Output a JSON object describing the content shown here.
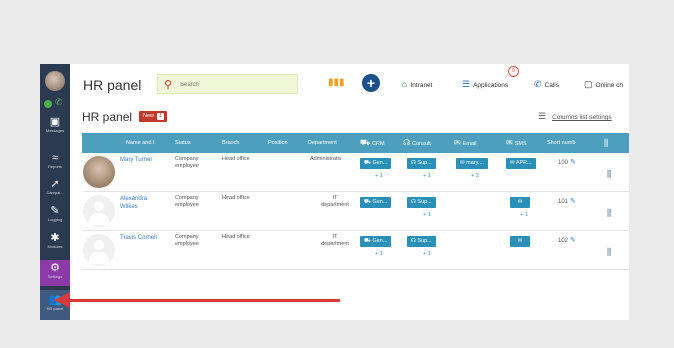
{
  "sidebar": {
    "items": [
      {
        "icon": "messages-icon",
        "label": "Messages"
      },
      {
        "icon": "reports-icon",
        "label": "Reports"
      },
      {
        "icon": "campaigns-icon",
        "label": "Campai..."
      },
      {
        "icon": "logging-icon",
        "label": "Logging"
      },
      {
        "icon": "modules-icon",
        "label": "Modules"
      },
      {
        "icon": "settings-icon",
        "label": "Settings"
      },
      {
        "icon": "hr-panel-icon",
        "label": "HR panel"
      }
    ]
  },
  "header": {
    "app_title": "HR panel",
    "search_placeholder": "Search",
    "links": [
      {
        "label": "Intranet"
      },
      {
        "label": "Applications"
      },
      {
        "label": "Calls"
      },
      {
        "label": "Online ch"
      }
    ],
    "applications_badge": "0"
  },
  "page": {
    "title": "HR panel",
    "new_label": "New",
    "new_count": "1",
    "columns_settings": "Columns list settings"
  },
  "table": {
    "headers": {
      "name": "Name and l",
      "status": "Status",
      "branch": "Branch",
      "position": "Position",
      "department": "Department",
      "crm": "CRM",
      "consult": "Consult",
      "email": "Email",
      "sms": "SMS",
      "short": "Short numb"
    },
    "rows": [
      {
        "name": "Mary Turner",
        "status": "Company employee",
        "branch": "Head office",
        "department": "Administrativ",
        "crm": "Gen...",
        "crm_plus": "+ 1",
        "consult": "Sup...",
        "consult_plus": "+ 1",
        "email": "mary....",
        "email_plus": "+ 2",
        "sms": "APR...",
        "short": "100"
      },
      {
        "name": "Alexandra Wilkes",
        "status": "Company employee",
        "branch": "Head office",
        "department": "IT department",
        "crm": "Gen...",
        "crm_plus": "",
        "consult": "Sup...",
        "consult_plus": "+ 1",
        "email": "",
        "email_plus": "",
        "sms": "",
        "short": "101"
      },
      {
        "name": "Travis Cornell",
        "status": "Company employee",
        "branch": "Head office",
        "department": "IT department",
        "crm": "Gen...",
        "crm_plus": "+ 1",
        "consult": "Sup...",
        "consult_plus": "+ 1",
        "email": "",
        "email_plus": "",
        "sms": "",
        "short": "102"
      }
    ]
  },
  "colors": {
    "accent": "#4d9fbd",
    "sidebar": "#2b3a4f",
    "arrow": "#d63a3a",
    "new_badge": "#c0392b"
  }
}
